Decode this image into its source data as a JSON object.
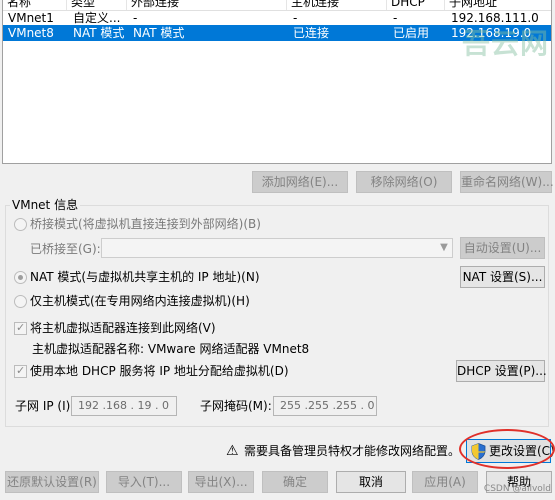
{
  "table": {
    "headers": [
      "名称",
      "类型",
      "外部连接",
      "主机连接",
      "DHCP",
      "子网地址"
    ],
    "rows": [
      {
        "name": "VMnet1",
        "type": "自定义...",
        "external": "-",
        "host": "-",
        "dhcp": "-",
        "subnet": "192.168.111.0",
        "selected": false
      },
      {
        "name": "VMnet8",
        "type": "NAT 模式",
        "external": "NAT 模式",
        "host": "已连接",
        "dhcp": "已启用",
        "subnet": "192.168.19.0",
        "selected": true
      }
    ]
  },
  "watermark": "吾云网",
  "table_buttons": {
    "add": "添加网络(E)...",
    "remove": "移除网络(O)",
    "rename": "重命名网络(W)..."
  },
  "vmnet_info": {
    "title": "VMnet 信息",
    "bridged_label": "桥接模式(将虚拟机直接连接到外部网络)(B)",
    "bridged_to_label": "已桥接至(G):",
    "bridged_to_value": "",
    "auto_settings": "自动设置(U)...",
    "nat_label": "NAT 模式(与虚拟机共享主机的 IP 地址)(N)",
    "nat_settings": "NAT 设置(S)...",
    "host_only_label": "仅主机模式(在专用网络内连接虚拟机)(H)",
    "connect_adapter_label": "将主机虚拟适配器连接到此网络(V)",
    "adapter_name_label": "主机虚拟适配器名称: VMware 网络适配器 VMnet8",
    "dhcp_label": "使用本地 DHCP 服务将 IP 地址分配给虚拟机(D)",
    "dhcp_settings": "DHCP 设置(P)...",
    "subnet_ip_label": "子网 IP (I):",
    "subnet_ip_value": "192 .168 . 19  .  0",
    "subnet_mask_label": "子网掩码(M):",
    "subnet_mask_value": "255 .255 .255 .  0"
  },
  "admin_notice": "需要具备管理员特权才能修改网络配置。",
  "change_settings": "更改设置(C)",
  "footer": {
    "restore": "还原默认设置(R)",
    "import": "导入(T)...",
    "export": "导出(X)...",
    "ok": "确定",
    "cancel": "取消",
    "apply": "应用(A)",
    "help": "帮助"
  },
  "credit": "CSDN @allvold"
}
